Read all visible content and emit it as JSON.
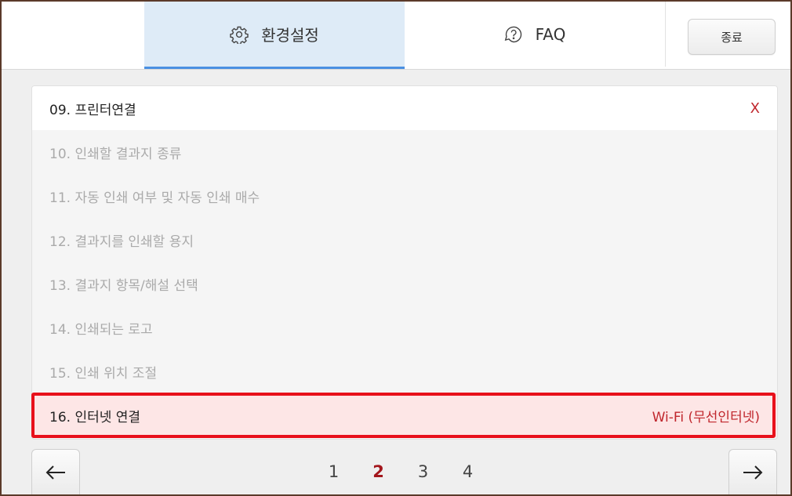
{
  "header": {
    "tabs": [
      {
        "label": "환경설정",
        "icon": "gear-icon",
        "active": true
      },
      {
        "label": "FAQ",
        "icon": "question-icon",
        "active": false
      }
    ],
    "close_label": "종료"
  },
  "list": {
    "items": [
      {
        "label": "09. 프린터연결",
        "value": "X",
        "state": "active"
      },
      {
        "label": "10. 인쇄할 결과지 종류",
        "value": "",
        "state": "disabled"
      },
      {
        "label": "11. 자동 인쇄 여부 및 자동 인쇄 매수",
        "value": "",
        "state": "disabled"
      },
      {
        "label": "12. 결과지를 인쇄할 용지",
        "value": "",
        "state": "disabled"
      },
      {
        "label": "13. 결과지 항목/해설 선택",
        "value": "",
        "state": "disabled"
      },
      {
        "label": "14. 인쇄되는 로고",
        "value": "",
        "state": "disabled"
      },
      {
        "label": "15. 인쇄 위치 조절",
        "value": "",
        "state": "disabled"
      },
      {
        "label": "16. 인터넷 연결",
        "value": "Wi-Fi (무선인터넷)",
        "state": "selected"
      }
    ]
  },
  "pagination": {
    "pages": [
      "1",
      "2",
      "3",
      "4"
    ],
    "current": "2",
    "prev_icon": "arrow-left-icon",
    "next_icon": "arrow-right-icon"
  },
  "colors": {
    "accent_blue": "#4a90e2",
    "tab_active_bg": "#deebf7",
    "highlight_red": "#e8101b",
    "value_red": "#c0272d",
    "current_page": "#a3161c"
  }
}
